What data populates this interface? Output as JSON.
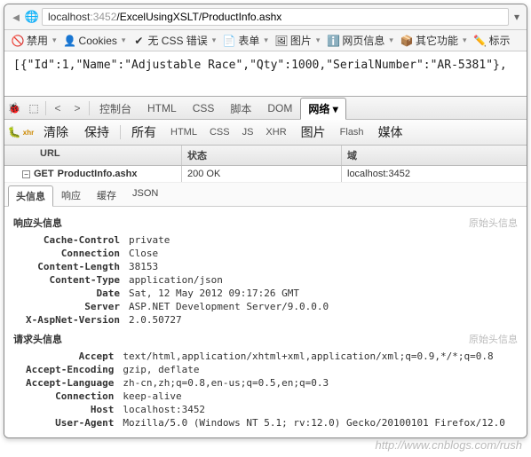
{
  "address": {
    "host": "localhost",
    "port": ":3452",
    "path": "/ExcelUsingXSLT/ProductInfo.ashx"
  },
  "toolbar": {
    "disable": "禁用",
    "cookies": "Cookies",
    "css": "无 CSS 错误",
    "forms": "表单",
    "images": "图片",
    "info": "网页信息",
    "misc": "其它功能",
    "mark": "标示"
  },
  "response_body": "[{\"Id\":1,\"Name\":\"Adjustable Race\",\"Qty\":1000,\"SerialNumber\":\"AR-5381\"},",
  "dt_tabs": {
    "console": "控制台",
    "html": "HTML",
    "css": "CSS",
    "script": "脚本",
    "dom": "DOM",
    "net": "网络"
  },
  "sub": {
    "clear": "清除",
    "persist": "保持",
    "all": "所有",
    "html": "HTML",
    "css": "CSS",
    "js": "JS",
    "xhr": "XHR",
    "images": "图片",
    "flash": "Flash",
    "media": "媒体"
  },
  "net_cols": {
    "url": "URL",
    "status": "状态",
    "domain": "域"
  },
  "net_row": {
    "method": "GET",
    "file": "ProductInfo.ashx",
    "status": "200 OK",
    "domain": "localhost:3452"
  },
  "detail_tabs": {
    "headers": "头信息",
    "response": "响应",
    "cache": "缓存",
    "json": "JSON"
  },
  "resp_section": "响应头信息",
  "req_section": "请求头信息",
  "raw": "原始头信息",
  "resp_headers": [
    {
      "k": "Cache-Control",
      "v": "private"
    },
    {
      "k": "Connection",
      "v": "Close"
    },
    {
      "k": "Content-Length",
      "v": "38153"
    },
    {
      "k": "Content-Type",
      "v": "application/json"
    },
    {
      "k": "Date",
      "v": "Sat, 12 May 2012 09:17:26 GMT"
    },
    {
      "k": "Server",
      "v": "ASP.NET Development Server/9.0.0.0"
    },
    {
      "k": "X-AspNet-Version",
      "v": "2.0.50727"
    }
  ],
  "req_headers": [
    {
      "k": "Accept",
      "v": "text/html,application/xhtml+xml,application/xml;q=0.9,*/*;q=0.8"
    },
    {
      "k": "Accept-Encoding",
      "v": "gzip, deflate"
    },
    {
      "k": "Accept-Language",
      "v": "zh-cn,zh;q=0.8,en-us;q=0.5,en;q=0.3"
    },
    {
      "k": "Connection",
      "v": "keep-alive"
    },
    {
      "k": "Host",
      "v": "localhost:3452"
    },
    {
      "k": "User-Agent",
      "v": "Mozilla/5.0 (Windows NT 5.1; rv:12.0) Gecko/20100101 Firefox/12.0"
    }
  ],
  "watermark": "http://www.cnblogs.com/rush"
}
